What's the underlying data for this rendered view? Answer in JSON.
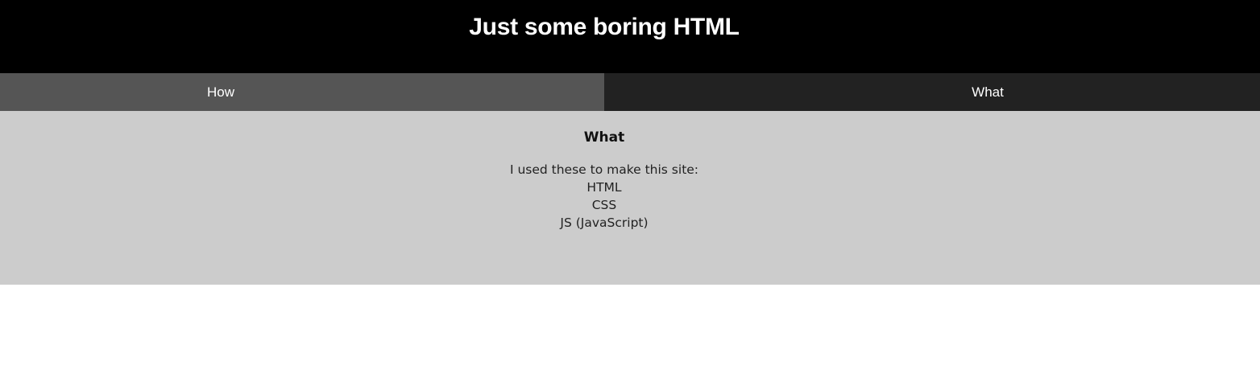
{
  "header": {
    "title": "Just some boring HTML"
  },
  "tabs": [
    {
      "label": "How"
    },
    {
      "label": "What"
    }
  ],
  "content": {
    "title": "What",
    "lines": [
      "I used these to make this site:",
      "HTML",
      "CSS",
      "JS (JavaScript)"
    ]
  },
  "colors": {
    "header_bg": "#000000",
    "tab_how_bg": "#555555",
    "tab_what_bg": "#222222",
    "content_bg": "#cccccc"
  }
}
